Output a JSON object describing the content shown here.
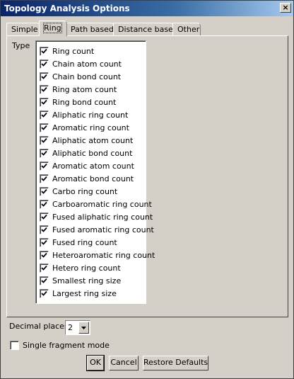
{
  "window": {
    "title": "Topology Analysis Options",
    "close_glyph": "×"
  },
  "tabs": [
    {
      "label": "Simple"
    },
    {
      "label": "Ring",
      "active": true
    },
    {
      "label": "Path based"
    },
    {
      "label": "Distance based"
    },
    {
      "label": "Other"
    }
  ],
  "type_label": "Type",
  "ring_types": [
    {
      "label": "Ring count",
      "checked": true
    },
    {
      "label": "Chain atom count",
      "checked": true
    },
    {
      "label": "Chain bond count",
      "checked": true
    },
    {
      "label": "Ring atom count",
      "checked": true
    },
    {
      "label": "Ring bond count",
      "checked": true
    },
    {
      "label": "Aliphatic ring count",
      "checked": true
    },
    {
      "label": "Aromatic ring count",
      "checked": true
    },
    {
      "label": "Aliphatic atom count",
      "checked": true
    },
    {
      "label": "Aliphatic bond count",
      "checked": true
    },
    {
      "label": "Aromatic atom count",
      "checked": true
    },
    {
      "label": "Aromatic bond count",
      "checked": true
    },
    {
      "label": "Carbo ring count",
      "checked": true
    },
    {
      "label": "Carboaromatic ring count",
      "checked": true
    },
    {
      "label": "Fused aliphatic ring count",
      "checked": true
    },
    {
      "label": "Fused aromatic ring count",
      "checked": true
    },
    {
      "label": "Fused ring count",
      "checked": true
    },
    {
      "label": "Heteroaromatic ring count",
      "checked": true
    },
    {
      "label": "Hetero ring count",
      "checked": true
    },
    {
      "label": "Smallest ring size",
      "checked": true
    },
    {
      "label": "Largest ring size",
      "checked": true
    }
  ],
  "decimal_places": {
    "label": "Decimal places",
    "value": "2"
  },
  "single_fragment_mode": {
    "label": "Single fragment mode",
    "checked": false
  },
  "buttons": {
    "ok": "OK",
    "cancel": "Cancel",
    "restore": "Restore Defaults"
  },
  "icons": {
    "check": "check-icon",
    "combo_arrow": "triangle-down-icon"
  }
}
